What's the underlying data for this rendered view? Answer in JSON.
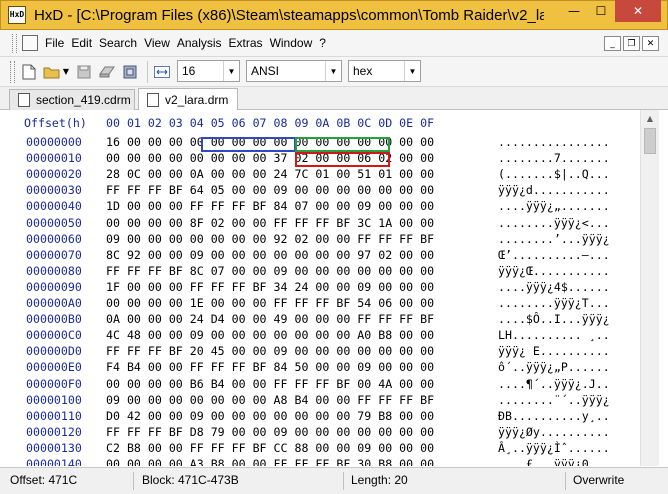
{
  "window": {
    "title": "HxD - [C:\\Program Files (x86)\\Steam\\steamapps\\common\\Tomb Raider\\v2_lar...",
    "app_icon_text": "HxD",
    "minimize": "—",
    "maximize": "☐",
    "close": "✕"
  },
  "menu": {
    "items": [
      "File",
      "Edit",
      "Search",
      "View",
      "Analysis",
      "Extras",
      "Window",
      "?"
    ],
    "mdi_minimize": "_",
    "mdi_restore": "❐",
    "mdi_close": "✕"
  },
  "toolbar": {
    "bytes_per_row": "16",
    "charset": "ANSI",
    "offset_base": "hex"
  },
  "tabs": [
    {
      "label": "section_419.cdrm",
      "active": false
    },
    {
      "label": "v2_lara.drm",
      "active": true
    }
  ],
  "hex_view": {
    "offset_header": "Offset(h)",
    "column_headers": "00 01 02 03 04 05 06 07 08 09 0A 0B 0C 0D 0E 0F",
    "rows": [
      {
        "offset": "00000000",
        "hex": "16 00 00 00 00 00 00 00 00 00 00 00 00 00 00 00",
        "ascii": "................"
      },
      {
        "offset": "00000010",
        "hex": "00 00 00 00 00 00 00 00 37 02 00 00 06 02 00 00",
        "ascii": "........7......."
      },
      {
        "offset": "00000020",
        "hex": "28 0C 00 00 0A 00 00 00 24 7C 01 00 51 01 00 00",
        "ascii": "(.......$|..Q..."
      },
      {
        "offset": "00000030",
        "hex": "FF FF FF BF 64 05 00 00 09 00 00 00 00 00 00 00",
        "ascii": "ÿÿÿ¿d..........."
      },
      {
        "offset": "00000040",
        "hex": "1D 00 00 00 FF FF FF BF 84 07 00 00 09 00 00 00",
        "ascii": "....ÿÿÿ¿„......."
      },
      {
        "offset": "00000050",
        "hex": "00 00 00 00 8F 02 00 00 FF FF FF BF 3C 1A 00 00",
        "ascii": "........ÿÿÿ¿<..."
      },
      {
        "offset": "00000060",
        "hex": "09 00 00 00 00 00 00 00 92 02 00 00 FF FF FF BF",
        "ascii": "........’...ÿÿÿ¿"
      },
      {
        "offset": "00000070",
        "hex": "8C 92 00 00 09 00 00 00 00 00 00 00 97 02 00 00",
        "ascii": "Œ’..........—..."
      },
      {
        "offset": "00000080",
        "hex": "FF FF FF BF 8C 07 00 00 09 00 00 00 00 00 00 00",
        "ascii": "ÿÿÿ¿Œ..........."
      },
      {
        "offset": "00000090",
        "hex": "1F 00 00 00 FF FF FF BF 34 24 00 00 09 00 00 00",
        "ascii": "....ÿÿÿ¿4$......"
      },
      {
        "offset": "000000A0",
        "hex": "00 00 00 00 1E 00 00 00 FF FF FF BF 54 06 00 00",
        "ascii": "........ÿÿÿ¿T..."
      },
      {
        "offset": "000000B0",
        "hex": "0A 00 00 00 24 D4 00 00 49 00 00 00 FF FF FF BF",
        "ascii": "....$Ô..I...ÿÿÿ¿"
      },
      {
        "offset": "000000C0",
        "hex": "4C 48 00 00 09 00 00 00 00 00 00 00 A0 B8 00 00",
        "ascii": "LH.......... ¸.."
      },
      {
        "offset": "000000D0",
        "hex": "FF FF FF BF 20 45 00 00 09 00 00 00 00 00 00 00",
        "ascii": "ÿÿÿ¿ E.........."
      },
      {
        "offset": "000000E0",
        "hex": "F4 B4 00 00 FF FF FF BF 84 50 00 00 09 00 00 00",
        "ascii": "ô´..ÿÿÿ¿„P......"
      },
      {
        "offset": "000000F0",
        "hex": "00 00 00 00 B6 B4 00 00 FF FF FF BF 00 4A 00 00",
        "ascii": "....¶´..ÿÿÿ¿.J.."
      },
      {
        "offset": "00000100",
        "hex": "09 00 00 00 00 00 00 00 A8 B4 00 00 FF FF FF BF",
        "ascii": "........¨´..ÿÿÿ¿"
      },
      {
        "offset": "00000110",
        "hex": "D0 42 00 00 09 00 00 00 00 00 00 00 79 B8 00 00",
        "ascii": "ÐB..........y¸.."
      },
      {
        "offset": "00000120",
        "hex": "FF FF FF BF D8 79 00 00 09 00 00 00 00 00 00 00",
        "ascii": "ÿÿÿ¿Øy.........."
      },
      {
        "offset": "00000130",
        "hex": "C2 B8 00 00 FF FF FF BF CC 88 00 00 09 00 00 00",
        "ascii": "Â¸..ÿÿÿ¿Ìˆ......"
      },
      {
        "offset": "00000140",
        "hex": "00 00 00 00 A3 B8 00 00 FF FF FF BF 30 B8 00 00",
        "ascii": "....£¸..ÿÿÿ¿0¸.."
      }
    ]
  },
  "status": {
    "offset": "Offset: 471C",
    "block": "Block: 471C-473B",
    "length": "Length: 20",
    "mode": "Overwrite"
  },
  "colors": {
    "title_bar": "#f0c040",
    "offset_text": "#1a2a9a",
    "highlight_blue": "#3048c0",
    "highlight_green": "#28a040",
    "highlight_red": "#d01818"
  }
}
